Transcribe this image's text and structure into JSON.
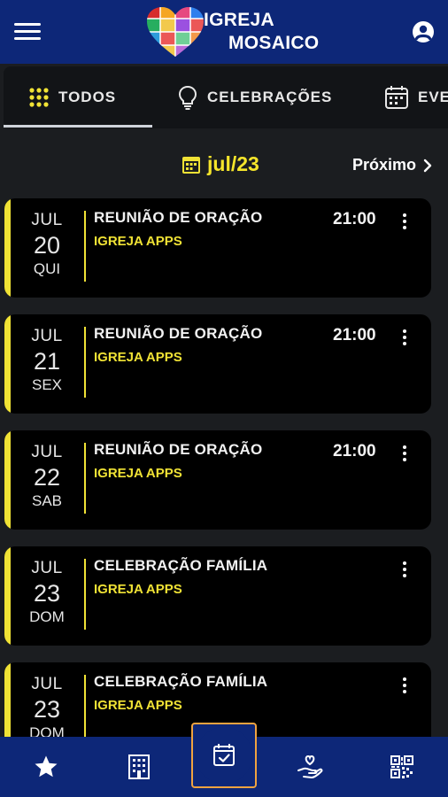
{
  "app": {
    "logo_line1": "IGREJA",
    "logo_line2": "MOSAICO"
  },
  "tabs": [
    {
      "label": "TODOS",
      "icon": "grid-dots-icon",
      "active": true
    },
    {
      "label": "CELEBRAÇÕES",
      "icon": "lightbulb-icon",
      "active": false
    },
    {
      "label": "EVE",
      "icon": "calendar-icon",
      "active": false
    }
  ],
  "month_nav": {
    "current": "jul/23",
    "next_label": "Próximo"
  },
  "events": [
    {
      "month": "JUL",
      "day": "20",
      "weekday": "QUI",
      "title": "REUNIÃO DE ORAÇÃO",
      "org": "IGREJA APPS",
      "time": "21:00"
    },
    {
      "month": "JUL",
      "day": "21",
      "weekday": "SEX",
      "title": "REUNIÃO DE ORAÇÃO",
      "org": "IGREJA APPS",
      "time": "21:00"
    },
    {
      "month": "JUL",
      "day": "22",
      "weekday": "SAB",
      "title": "REUNIÃO DE ORAÇÃO",
      "org": "IGREJA APPS",
      "time": "21:00"
    },
    {
      "month": "JUL",
      "day": "23",
      "weekday": "DOM",
      "title": "CELEBRAÇÃO FAMÍLIA",
      "org": "IGREJA APPS",
      "time": ""
    },
    {
      "month": "JUL",
      "day": "23",
      "weekday": "DOM",
      "title": "CELEBRAÇÃO FAMÍLIA",
      "org": "IGREJA APPS",
      "time": ""
    }
  ],
  "bottom_nav": [
    {
      "icon": "star-icon"
    },
    {
      "icon": "building-icon"
    },
    {
      "icon": "calendar-check-icon",
      "active": true
    },
    {
      "icon": "hand-heart-icon"
    },
    {
      "icon": "qr-code-icon"
    }
  ],
  "colors": {
    "primary": "#0d2778",
    "accent": "#f0e235",
    "background": "#1b1d20",
    "card": "#000000"
  }
}
